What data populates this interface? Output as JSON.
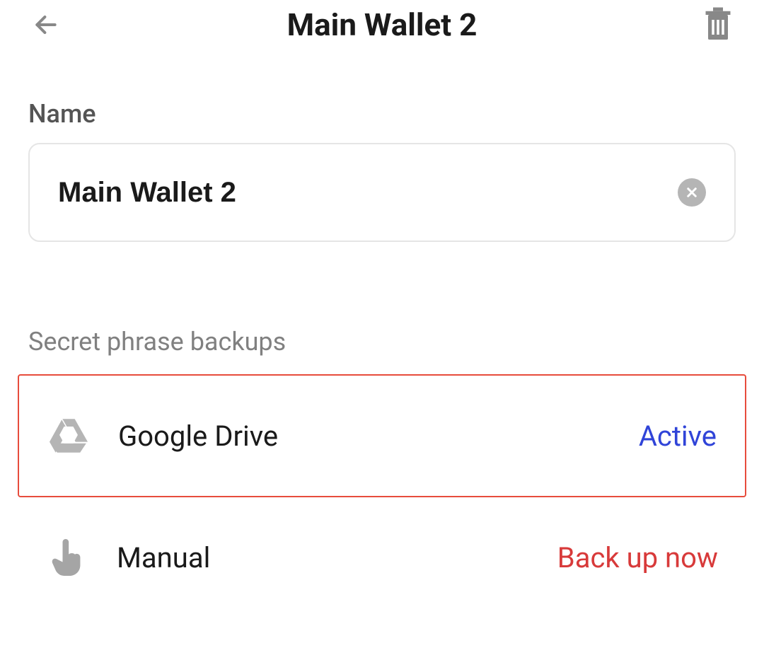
{
  "header": {
    "title": "Main Wallet 2"
  },
  "name_section": {
    "label": "Name",
    "value": "Main Wallet 2"
  },
  "backups": {
    "header": "Secret phrase backups",
    "items": [
      {
        "icon": "google-drive-icon",
        "label": "Google Drive",
        "status": "Active",
        "status_type": "active",
        "highlighted": true
      },
      {
        "icon": "hand-pointer-icon",
        "label": "Manual",
        "status": "Back up now",
        "status_type": "warning",
        "highlighted": false
      }
    ]
  }
}
